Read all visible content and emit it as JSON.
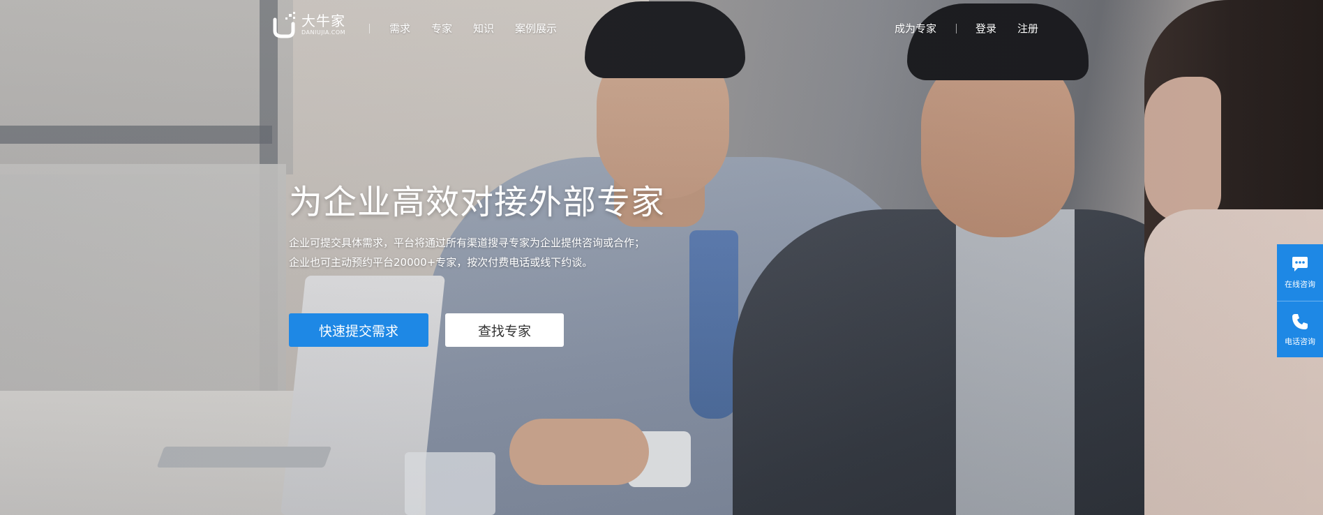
{
  "brand": {
    "name_cn": "大牛家",
    "name_en": "DANIUJIA.COM"
  },
  "nav": {
    "left_links": [
      "需求",
      "专家",
      "知识",
      "案例展示"
    ],
    "become_expert": "成为专家",
    "login": "登录",
    "register": "注册"
  },
  "hero": {
    "headline": "为企业高效对接外部专家",
    "desc_line1": "企业可提交具体需求，平台将通过所有渠道搜寻专家为企业提供咨询或合作；",
    "desc_line2": "企业也可主动预约平台20000+专家，按次付费电话或线下约谈。",
    "primary_button": "快速提交需求",
    "secondary_button": "查找专家"
  },
  "side_consult": {
    "online": "在线咨询",
    "phone": "电话咨询"
  },
  "colors": {
    "accent": "#1e88e5",
    "text_on_dark": "#ffffff"
  },
  "icons": [
    "chat-bubble-icon",
    "phone-icon",
    "logo-mark-icon"
  ]
}
